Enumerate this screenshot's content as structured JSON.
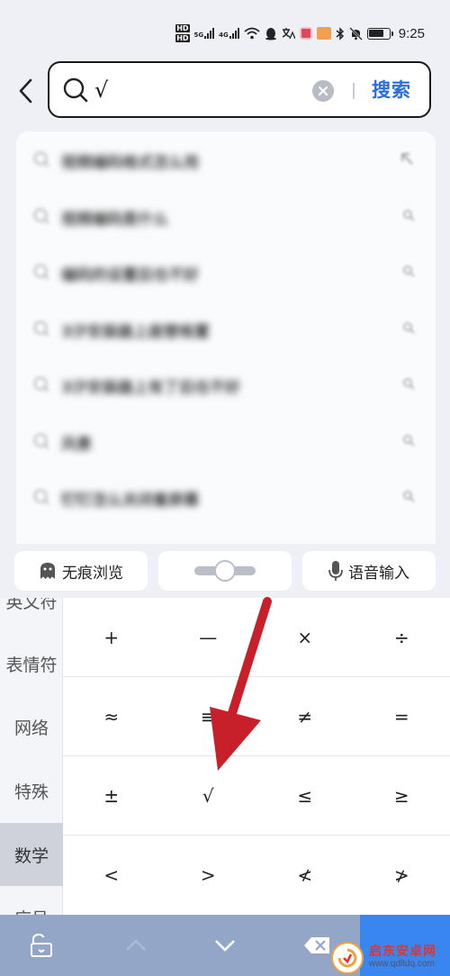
{
  "status_bar": {
    "hd1": "HD",
    "hd2": "HD",
    "net1": "5G",
    "net2": "4G",
    "time": "9:25",
    "battery_percent": 75
  },
  "search": {
    "query": "√",
    "submit_label": "搜索"
  },
  "history": {
    "items": [
      {
        "text": "视频编码格式怎么用"
      },
      {
        "text": "视频编码是什么"
      },
      {
        "text": "编码的设置后也不好"
      },
      {
        "text": "3汐安装器上座替格置"
      },
      {
        "text": "3汐安装器上有了后也不好"
      },
      {
        "text": "风景"
      },
      {
        "text": "钉钉怎么关闭着屏幕"
      }
    ]
  },
  "toolbar": {
    "incognito_label": "无痕浏览",
    "voice_label": "语音输入"
  },
  "categories": {
    "items": [
      {
        "label": "英文符"
      },
      {
        "label": "表情符"
      },
      {
        "label": "网络"
      },
      {
        "label": "特殊"
      },
      {
        "label": "数学"
      },
      {
        "label": "序号"
      }
    ],
    "active": "数学"
  },
  "symbols": {
    "rows": [
      [
        "+",
        "—",
        "×",
        "÷"
      ],
      [
        "≈",
        "≡",
        "≠",
        "="
      ],
      [
        "±",
        "√",
        "≤",
        "≥"
      ],
      [
        "<",
        ">",
        "≮",
        "≯"
      ]
    ]
  },
  "watermark": {
    "name": "启东安卓网",
    "url": "www.qdltdq.com"
  },
  "colors": {
    "accent": "#2a6fd8",
    "annotation_arrow": "#c8202a",
    "bottom_bar": "#94a6c8",
    "enter_key": "#3a86f0"
  }
}
